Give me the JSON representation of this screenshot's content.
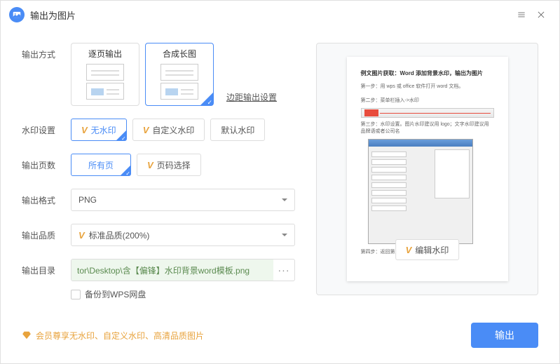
{
  "header": {
    "title": "输出为图片"
  },
  "rows": {
    "mode": {
      "label": "输出方式",
      "opt1": "逐页输出",
      "opt2": "合成长图",
      "margin_link": "边距输出设置"
    },
    "watermark": {
      "label": "水印设置",
      "none": "无水印",
      "custom": "自定义水印",
      "default": "默认水印"
    },
    "pages": {
      "label": "输出页数",
      "all": "所有页",
      "select": "页码选择"
    },
    "format": {
      "label": "输出格式",
      "value": "PNG"
    },
    "quality": {
      "label": "输出品质",
      "value": "标准品质(200%)"
    },
    "dir": {
      "label": "输出目录",
      "path": "tor\\Desktop\\含【偏锋】水印背景word模板.png"
    },
    "backup": {
      "label": "备份到WPS网盘"
    }
  },
  "preview": {
    "title": "例文图片获取：Word 添加背景水印，输出为图片",
    "step1": "第一步：用 wps 或 office 软件打开 word 文档。",
    "step2": "第二步：菜单栏插入->水印",
    "step3": "第三步：水印设置。图片水印建议用 logo；文字水印建议用品牌语或者公司名",
    "step4": "第四步：返回第三步设置好水印。",
    "edit": "编辑水印"
  },
  "footer": {
    "note": "会员尊享无水印、自定义水印、高清品质图片",
    "export": "输出"
  }
}
